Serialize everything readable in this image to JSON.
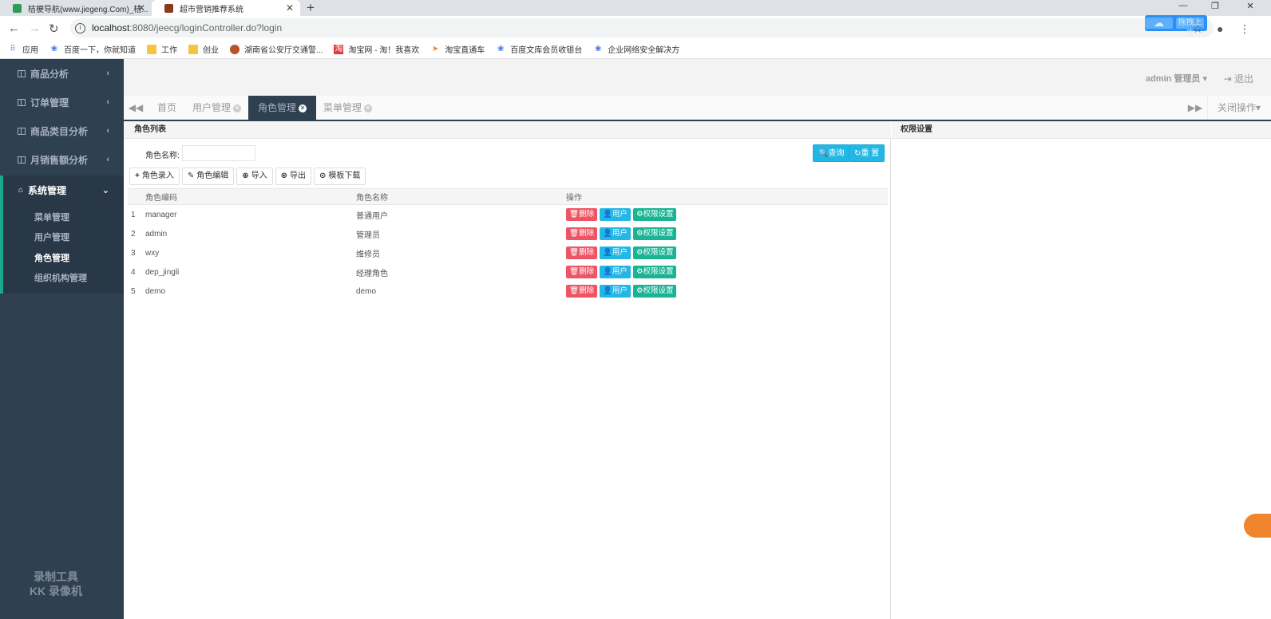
{
  "browser": {
    "tabs": [
      {
        "title": "桔梗导航(www.jiegeng.Com)_桔..."
      },
      {
        "title": "超市营销推荐系统"
      }
    ],
    "url_host": "localhost",
    "url_rest": ":8080/jeecg/loginController.do?login",
    "cloud_upload": "拖拽上传",
    "bookmarks": [
      "应用",
      "百度一下，你就知道",
      "工作",
      "创业",
      "湖南省公安厅交通警...",
      "淘宝网 - 淘！我喜欢",
      "淘宝直通车",
      "百度文库会员收银台",
      "企业网络安全解决方"
    ]
  },
  "sidebar": {
    "items": [
      {
        "label": "商品分析"
      },
      {
        "label": "订单管理"
      },
      {
        "label": "商品类目分析"
      },
      {
        "label": "月销售额分析"
      }
    ],
    "system": {
      "label": "系统管理"
    },
    "sub_items": [
      {
        "label": "菜单管理"
      },
      {
        "label": "用户管理"
      },
      {
        "label": "角色管理"
      },
      {
        "label": "组织机构管理"
      }
    ],
    "watermark_line1": "录制工具",
    "watermark_line2": "KK 录像机"
  },
  "header": {
    "user": "admin 管理员",
    "logout": "退出"
  },
  "page_tabs": [
    {
      "label": "首页"
    },
    {
      "label": "用户管理"
    },
    {
      "label": "角色管理"
    },
    {
      "label": "菜单管理"
    }
  ],
  "close_ops": "关闭操作",
  "role_panel": {
    "title": "角色列表",
    "search_label": "角色名称:",
    "search_value": "",
    "query_btn": "查询",
    "reset_btn": "重 置",
    "toolbar": [
      "角色录入",
      "角色编辑",
      "导入",
      "导出",
      "模板下载"
    ],
    "columns": {
      "code": "角色编码",
      "name": "角色名称",
      "ops": "操作"
    },
    "rows": [
      {
        "idx": "1",
        "code": "manager",
        "name": "普通用户"
      },
      {
        "idx": "2",
        "code": "admin",
        "name": "管理员"
      },
      {
        "idx": "3",
        "code": "wxy",
        "name": "维修员"
      },
      {
        "idx": "4",
        "code": "dep_jingli",
        "name": "经理角色"
      },
      {
        "idx": "5",
        "code": "demo",
        "name": "demo"
      }
    ],
    "op_labels": {
      "delete": "删除",
      "user": "用户",
      "perm": "权限设置"
    }
  },
  "perm_panel": {
    "title": "权限设置"
  },
  "colors": {
    "sidebar_bg": "#2f4050",
    "accent": "#19aa8d",
    "danger": "#ed5565",
    "info": "#23b7e5",
    "primary": "#1ab394"
  }
}
